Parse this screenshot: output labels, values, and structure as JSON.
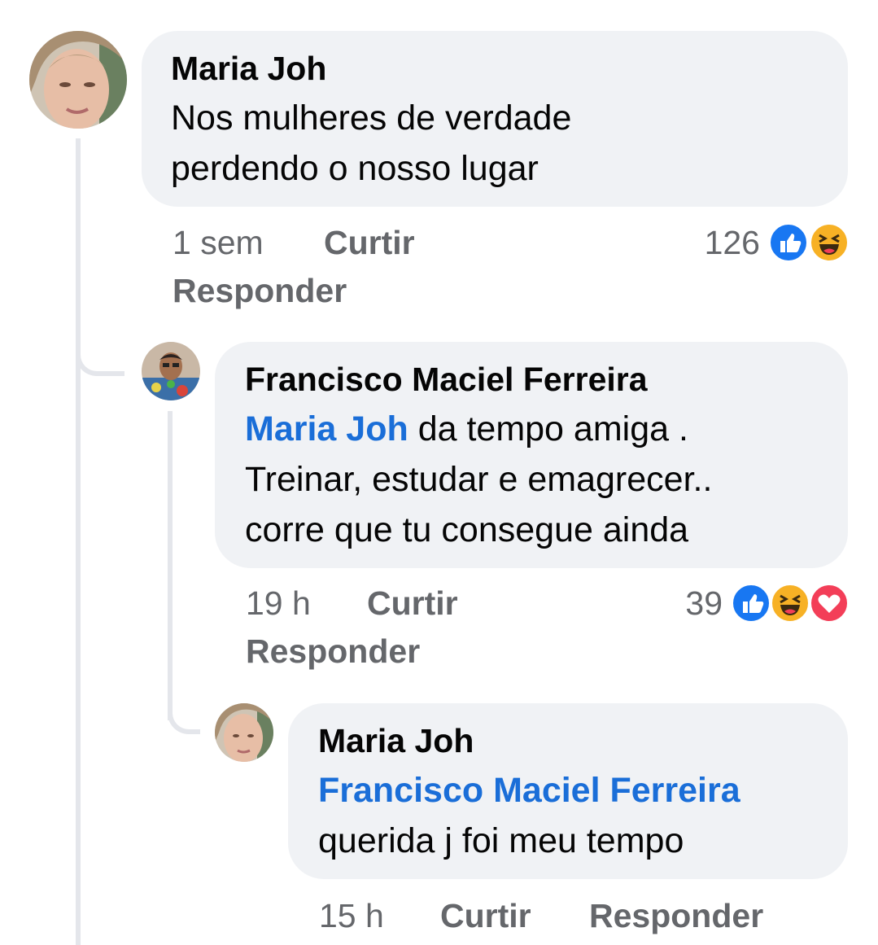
{
  "comments": [
    {
      "author": "Maria Joh",
      "text_lines": [
        "Nos mulheres de verdade",
        "perdendo o nosso lugar"
      ],
      "time": "1 sem",
      "like_label": "Curtir",
      "reply_label": "Responder",
      "reaction_count": "126",
      "reactions": [
        "like-reaction-icon",
        "haha-reaction-icon"
      ]
    },
    {
      "author": "Francisco Maciel Ferreira",
      "mention": "Maria Joh",
      "text_lines": [
        "da tempo amiga .",
        "Treinar, estudar e emagrecer..",
        "corre que tu consegue ainda"
      ],
      "time": "19 h",
      "like_label": "Curtir",
      "reply_label": "Responder",
      "reaction_count": "39",
      "reactions": [
        "like-reaction-icon",
        "haha-reaction-icon",
        "love-reaction-icon"
      ]
    },
    {
      "author": "Maria Joh",
      "mention": "Francisco Maciel Ferreira",
      "text_lines": [
        "querida j foi meu tempo"
      ],
      "time": "15 h",
      "like_label": "Curtir",
      "reply_label": "Responder"
    }
  ],
  "colors": {
    "bubble": "#f0f2f5",
    "mention": "#1a6ed8",
    "meta": "#65676b",
    "like": "#1877f2",
    "haha": "#f7b125",
    "love": "#f33e58"
  }
}
